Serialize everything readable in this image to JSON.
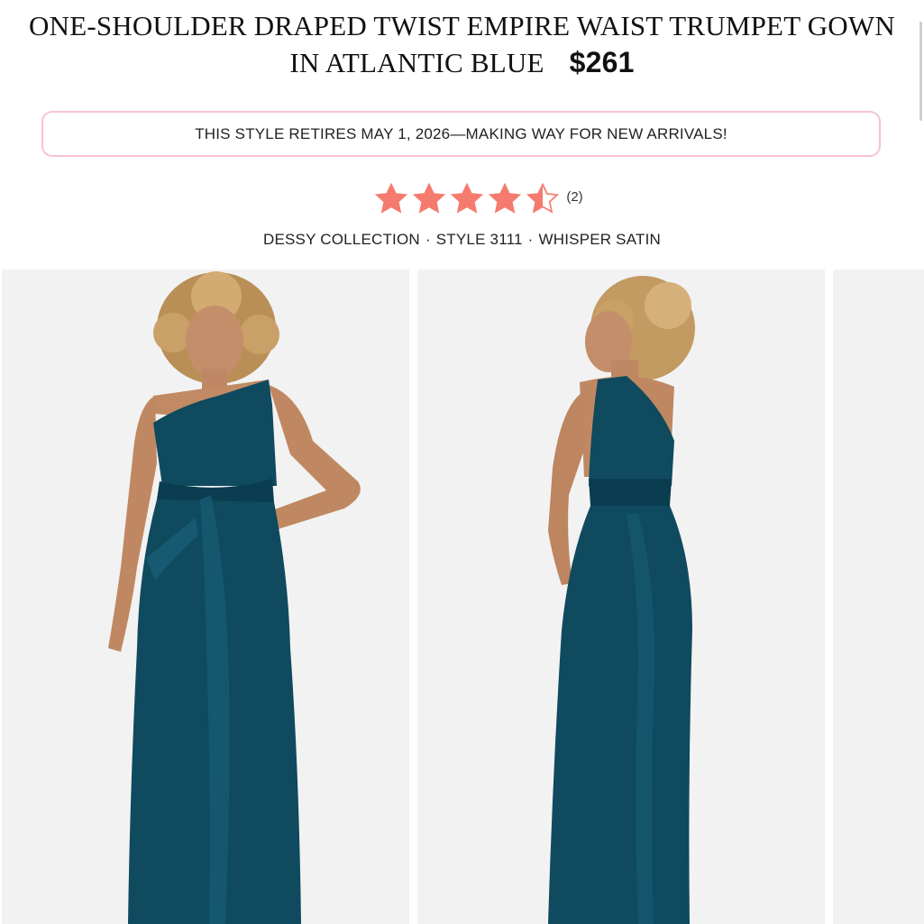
{
  "product": {
    "title": "ONE-SHOULDER DRAPED TWIST EMPIRE WAIST TRUMPET GOWN IN ATLANTIC BLUE",
    "title_line1": "ONE-SHOULDER DRAPED TWIST EMPIRE WAIST TRUMPET GOWN",
    "title_line2": "IN ATLANTIC BLUE",
    "price": "$261"
  },
  "banner": {
    "text": "THIS STYLE RETIRES MAY 1, 2026—MAKING WAY FOR NEW ARRIVALS!"
  },
  "rating": {
    "value": 4.5,
    "max": 5,
    "review_count": "(2)",
    "star_color": "#f47b6e"
  },
  "meta": {
    "collection": "DESSY COLLECTION",
    "style": "STYLE 3111",
    "fabric": "WHISPER SATIN",
    "separator": "·"
  },
  "gallery": {
    "images": [
      {
        "name": "front view",
        "dress_color": "#0f4a5f"
      },
      {
        "name": "back view",
        "dress_color": "#0f4a5f"
      },
      {
        "name": "partial next image"
      }
    ]
  }
}
